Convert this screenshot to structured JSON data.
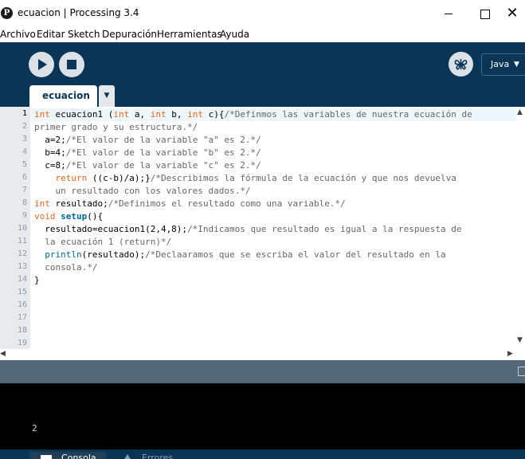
{
  "window": {
    "title": "ecuacion | Processing 3.4",
    "close_glyph": "✕"
  },
  "menu": [
    "Archivo",
    "Editar",
    "Sketch",
    "Depuración",
    "Herramientas",
    "Ayuda"
  ],
  "toolbar": {
    "mode": "Java",
    "mode_arrow": "▼"
  },
  "tabs": {
    "active": "ecuacion",
    "menu_glyph": "▼"
  },
  "editor": {
    "current_line": 1,
    "line_numbers": [
      "1",
      "2",
      "3",
      "4",
      "5",
      "6",
      "7",
      "8",
      "9",
      "10",
      "11",
      "12",
      "13",
      "14",
      "15",
      "16",
      "17",
      "18",
      "19"
    ],
    "lines": [
      [
        {
          "t": "int",
          "c": "kw"
        },
        {
          "t": " ecuacion1 (",
          "c": ""
        },
        {
          "t": "int",
          "c": "kw"
        },
        {
          "t": " a, ",
          "c": ""
        },
        {
          "t": "int",
          "c": "kw"
        },
        {
          "t": " b, ",
          "c": ""
        },
        {
          "t": "int",
          "c": "kw"
        },
        {
          "t": " c){",
          "c": ""
        },
        {
          "t": "/*Definmos las variables de nuestra ecuación de",
          "c": "cm"
        }
      ],
      [
        {
          "t": "primer grado y su estructura.*/",
          "c": "cm"
        }
      ],
      [
        {
          "t": "  a=2;",
          "c": ""
        },
        {
          "t": "/*El valor de la variable \"a\" es 2.*/",
          "c": "cm"
        }
      ],
      [
        {
          "t": "  b=4;",
          "c": ""
        },
        {
          "t": "/*El valor de la variable \"b\" es 2.*/",
          "c": "cm"
        }
      ],
      [
        {
          "t": "  c=8;",
          "c": ""
        },
        {
          "t": "/*El valor de la variable \"c\" es 2.*/",
          "c": "cm"
        }
      ],
      [
        {
          "t": "    ",
          "c": ""
        },
        {
          "t": "return",
          "c": "kw"
        },
        {
          "t": " ((c-b)/a);}",
          "c": ""
        },
        {
          "t": "/*Describimos la fórmula de la ecuación y que nos devuelva",
          "c": "cm"
        }
      ],
      [
        {
          "t": "    un resultado con los valores dados.*/",
          "c": "cm"
        }
      ],
      [
        {
          "t": "int",
          "c": "kw"
        },
        {
          "t": " resultado;",
          "c": ""
        },
        {
          "t": "/*Definimos el resultado como una variable.*/",
          "c": "cm"
        }
      ],
      [
        {
          "t": "void",
          "c": "kw"
        },
        {
          "t": " ",
          "c": ""
        },
        {
          "t": "setup",
          "c": "fn"
        },
        {
          "t": "(){",
          "c": ""
        }
      ],
      [
        {
          "t": "  resultado=ecuacion1(2,4,8);",
          "c": ""
        },
        {
          "t": "/*Indicamos que resultado es igual a la respuesta de",
          "c": "cm"
        }
      ],
      [
        {
          "t": "  la ecuación 1 (return)*/",
          "c": "cm"
        }
      ],
      [
        {
          "t": "  ",
          "c": ""
        },
        {
          "t": "println",
          "c": "fn2"
        },
        {
          "t": "(resultado);",
          "c": ""
        },
        {
          "t": "/*Declaaramos que se escriba el valor del resultado en la",
          "c": "cm"
        }
      ],
      [
        {
          "t": "  consola.*/",
          "c": "cm"
        }
      ],
      [
        {
          "t": "}",
          "c": ""
        }
      ]
    ]
  },
  "scroll": {
    "up": "▲",
    "down": "▼",
    "left": "◀",
    "right": "▶"
  },
  "console": {
    "output": "2"
  },
  "bottom_tabs": {
    "console": "Consola",
    "errors": "Errores"
  }
}
